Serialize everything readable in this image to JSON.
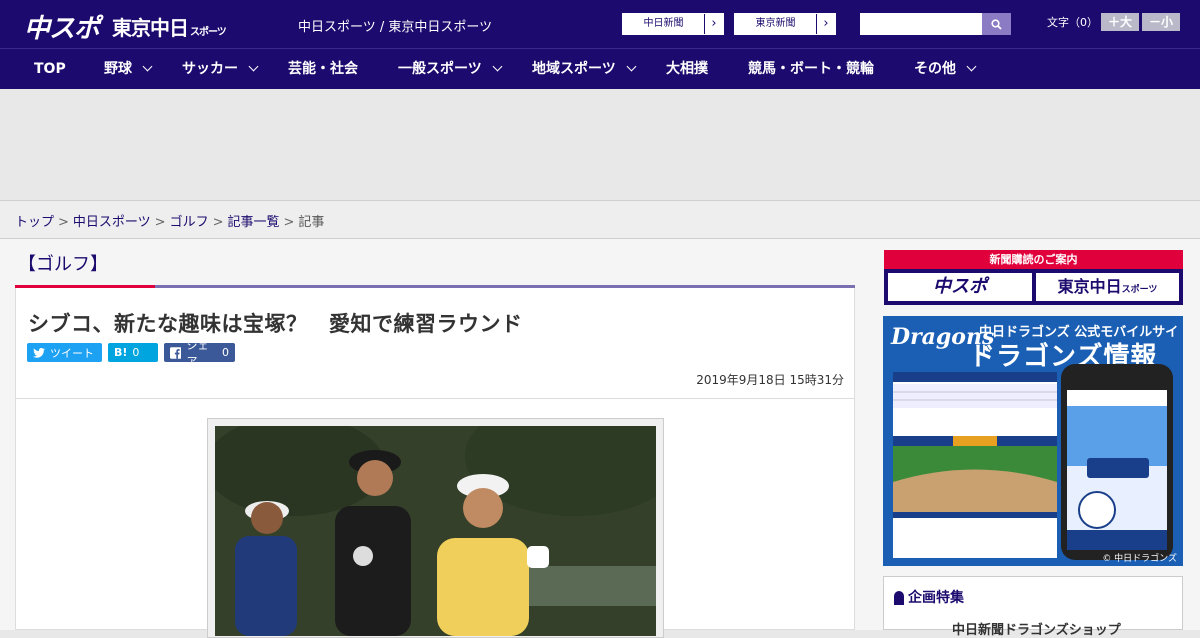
{
  "header": {
    "logo_main": "中スポ",
    "logo_tokyo": "東京中日",
    "logo_tokyo_suffix": "スポーツ",
    "site_names": "中日スポーツ / 東京中日スポーツ",
    "paper_buttons": [
      "中日新聞",
      "東京新聞"
    ],
    "search_placeholder": "",
    "text_size_label": "文字（0）",
    "size_plus": "＋大",
    "size_minus": "－小"
  },
  "nav": {
    "items": [
      {
        "label": "TOP",
        "dropdown": false
      },
      {
        "label": "野球",
        "dropdown": true
      },
      {
        "label": "サッカー",
        "dropdown": true
      },
      {
        "label": "芸能・社会",
        "dropdown": false
      },
      {
        "label": "一般スポーツ",
        "dropdown": true
      },
      {
        "label": "地域スポーツ",
        "dropdown": true
      },
      {
        "label": "大相撲",
        "dropdown": false
      },
      {
        "label": "競馬・ボート・競輪",
        "dropdown": false
      },
      {
        "label": "その他",
        "dropdown": true
      }
    ]
  },
  "breadcrumb": {
    "items": [
      "トップ",
      "中日スポーツ",
      "ゴルフ",
      "記事一覧"
    ],
    "current": "記事",
    "separator": ">"
  },
  "article": {
    "category": "【ゴルフ】",
    "headline": "シブコ、新たな趣味は宝塚？　愛知で練習ラウンド",
    "share": {
      "tweet_label": "ツイート",
      "hatena_icon": "B!",
      "hatena_count": "0",
      "facebook_label": "シェア",
      "facebook_count": "0"
    },
    "date": "2019年9月18日 15時31分"
  },
  "sidebar": {
    "subscribe_title": "新聞購読のご案内",
    "subscribe_papers": [
      "中スポ",
      "東京中日"
    ],
    "subscribe_tokyo_suffix": "スポーツ",
    "dragons_brand": "Dragons",
    "dragons_sub": "中日ドラゴンズ 公式モバイルサイト",
    "dragons_title": "ドラゴンズ情報",
    "dragons_copyright": "© 中日ドラゴンズ",
    "feature_title": "企画特集",
    "feature_item": "中日新聞ドラゴンズショップ"
  },
  "colors": {
    "brand_navy": "#1c0a6e",
    "accent_red": "#e0003c",
    "twitter": "#1da1f2",
    "hatena": "#00a4de",
    "facebook": "#3b5998",
    "dragons_blue": "#1a5fb4"
  }
}
